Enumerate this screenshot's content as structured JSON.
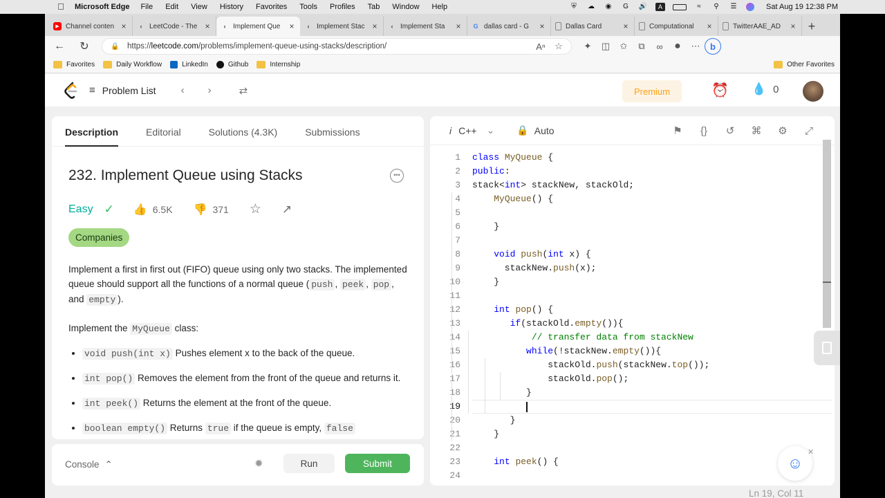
{
  "menubar": {
    "app": "Microsoft Edge",
    "items": [
      "File",
      "Edit",
      "View",
      "History",
      "Favorites",
      "Tools",
      "Profiles",
      "Tab",
      "Window",
      "Help"
    ],
    "clock": "Sat Aug 19  12:38 PM",
    "status_icons": [
      "shield-icon",
      "creative-cloud-icon",
      "grammarly-icon",
      "google-icon",
      "volume-icon",
      "input-source-icon",
      "battery-icon",
      "wifi-icon",
      "spotlight-icon",
      "control-center-icon",
      "siri-icon"
    ]
  },
  "tabs": [
    {
      "label": "Channel conten",
      "icon": "youtube-icon",
      "color": "#ff0000"
    },
    {
      "label": "LeetCode - The",
      "icon": "leetcode-icon",
      "color": "#ffa116"
    },
    {
      "label": "Implement Que",
      "icon": "leetcode-icon",
      "color": "#ffa116",
      "active": true
    },
    {
      "label": "Implement Stac",
      "icon": "leetcode-icon",
      "color": "#ffa116"
    },
    {
      "label": "Implement Sta",
      "icon": "leetcode-icon",
      "color": "#ffa116"
    },
    {
      "label": "dallas card - G",
      "icon": "google-icon",
      "color": "#4285f4"
    },
    {
      "label": "Dallas Card",
      "icon": "page-icon",
      "color": "#888888"
    },
    {
      "label": "Computational",
      "icon": "page-icon",
      "color": "#888888"
    },
    {
      "label": "TwitterAAE_AD",
      "icon": "page-icon",
      "color": "#888888"
    }
  ],
  "address": {
    "prefix": "https://",
    "domain": "leetcode.com",
    "path": "/problems/implement-queue-using-stacks/description/"
  },
  "favorites": [
    {
      "label": "Favorites",
      "icon": "folder-icon"
    },
    {
      "label": "Daily Workflow",
      "icon": "folder-icon"
    },
    {
      "label": "LinkedIn",
      "icon": "linkedin-icon"
    },
    {
      "label": "Github",
      "icon": "github-icon"
    },
    {
      "label": "Internship",
      "icon": "folder-icon"
    }
  ],
  "other_favorites": "Other Favorites",
  "lc_nav": {
    "problem_list": "Problem List",
    "premium": "Premium",
    "streak": "0"
  },
  "desc_tabs": [
    "Description",
    "Editorial",
    "Solutions (4.3K)",
    "Submissions"
  ],
  "problem": {
    "title": "232. Implement Queue using Stacks",
    "difficulty": "Easy",
    "likes": "6.5K",
    "dislikes": "371",
    "companies": "Companies",
    "p1_text": "Implement a first in first out (FIFO) queue using only two stacks. The implemented queue should support all the functions of a normal queue (",
    "p1_codes": [
      "push",
      "peek",
      "pop",
      "empty"
    ],
    "p1_and": ", and ",
    "p1_end": ").",
    "p2_pre": "Implement the ",
    "p2_code": "MyQueue",
    "p2_post": " class:",
    "bullets": [
      {
        "code": "void push(int x)",
        "text": " Pushes element x to the back of the queue."
      },
      {
        "code": "int pop()",
        "text": " Removes the element from the front of the queue and returns it."
      },
      {
        "code": "int peek()",
        "text": " Returns the element at the front of the queue."
      },
      {
        "code": "boolean empty()",
        "text": " Returns ",
        "code2": "true",
        "text2": " if the queue is empty, ",
        "code3": "false"
      }
    ]
  },
  "console": {
    "label": "Console",
    "run": "Run",
    "submit": "Submit"
  },
  "editor": {
    "lang": "C++",
    "lang_prefix": "i",
    "auto": "Auto",
    "cursor": "Ln 19, Col 11",
    "current_line": 19,
    "lines": [
      "class MyQueue {",
      "public:",
      "stack<int> stackNew, stackOld;",
      "    MyQueue() {",
      "",
      "    }",
      "",
      "    void push(int x) {",
      "      stackNew.push(x);",
      "    }",
      "",
      "    int pop() {",
      "       if(stackOld.empty()){",
      "           // transfer data from stackNew",
      "          while(!stackNew.empty()){",
      "              stackOld.push(stackNew.top());",
      "              stackOld.pop();",
      "          }",
      "",
      "       }",
      "    }",
      "",
      "    int peek() {",
      ""
    ]
  }
}
